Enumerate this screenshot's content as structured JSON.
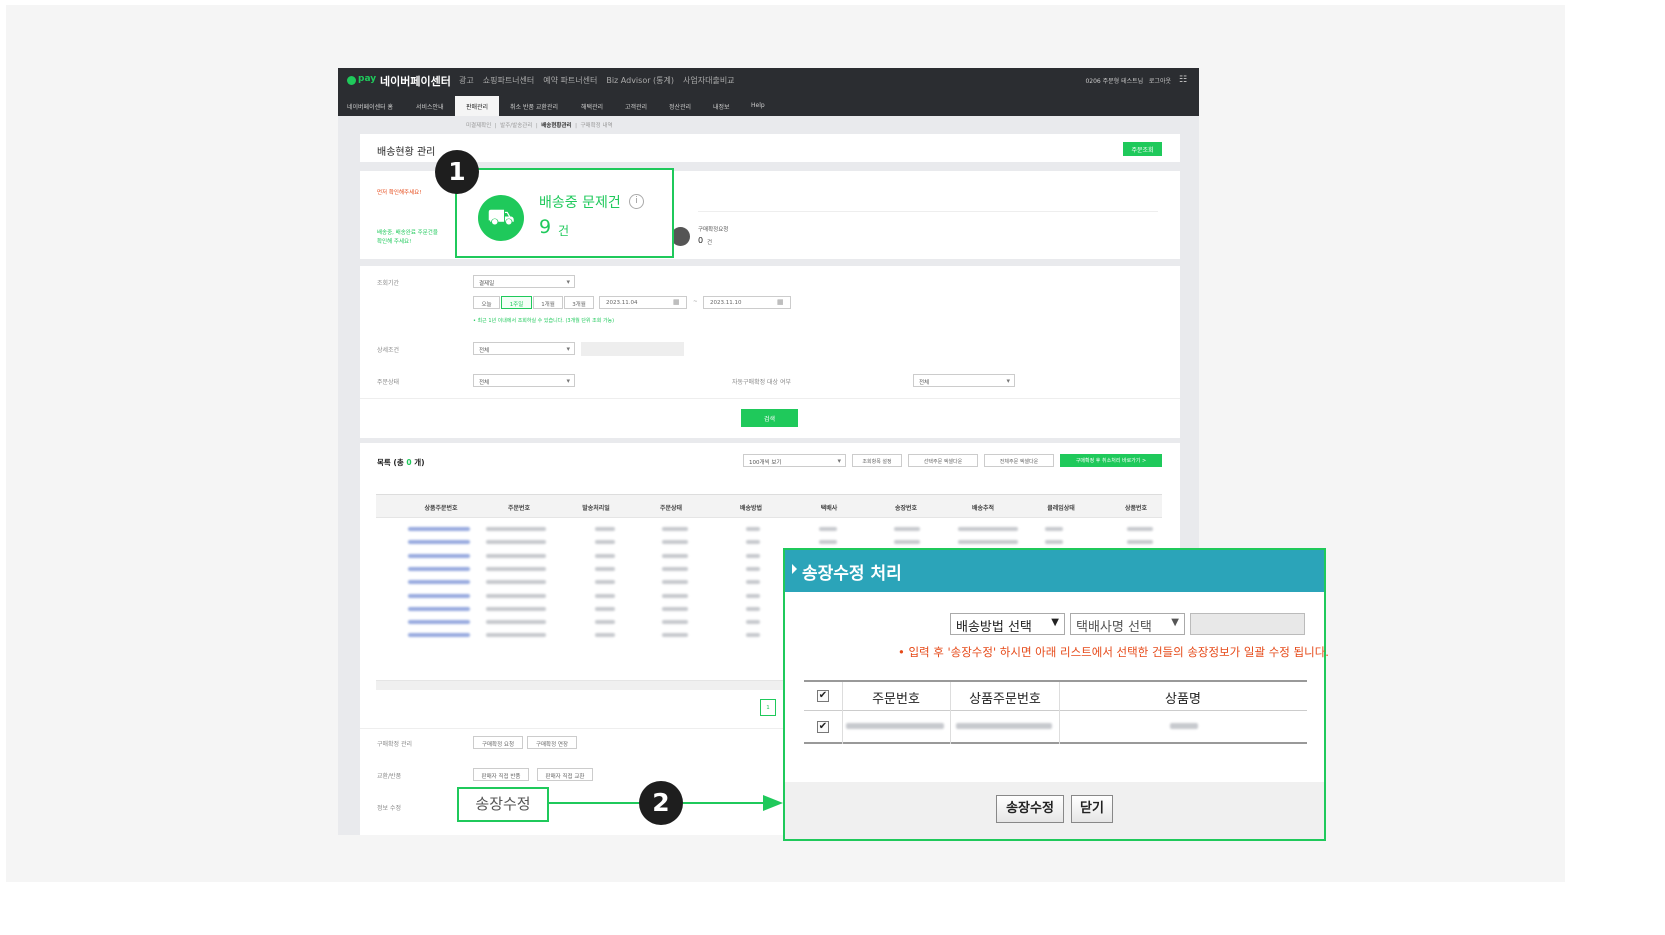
{
  "topbar": {
    "logo": "pay",
    "brand": "네이버페이센터",
    "nav": [
      "광고",
      "쇼핑파트너센터",
      "예약 파트너센터",
      "Biz Advisor (통계)",
      "사업자대출비교"
    ],
    "user": "0206 주문형 테스트님",
    "logout": "로그아웃"
  },
  "subnav": {
    "items": [
      "네이버페이센터 홈",
      "서비스안내",
      "판매관리",
      "취소 반품 교환관리",
      "해택관리",
      "고객관리",
      "정산관리",
      "내정보",
      "Help"
    ],
    "active": "판매관리"
  },
  "breadcrumb": {
    "items": [
      "미결제확인",
      "발주/발송관리",
      "배송현황관리",
      "구매확정 내역"
    ],
    "current": "배송현황관리"
  },
  "page": {
    "title": "배송현황 관리",
    "order_search_button": "주문조회"
  },
  "summary": {
    "notice": "먼저 확인해주세요!",
    "hint_line1": "배송중, 배송완료 주문건을",
    "hint_line2": "확인해 주세요!",
    "purchase_confirm_label": "구매확정요청",
    "purchase_confirm_count": "0",
    "purchase_confirm_unit": "건"
  },
  "filters": {
    "period_label": "조회기간",
    "period_type": "결제일",
    "ranges": [
      "오늘",
      "1주일",
      "1개월",
      "3개월"
    ],
    "active_range": "1주일",
    "date_from": "2023.11.04",
    "date_to": "2023.11.10",
    "date_sep": "~",
    "range_note": "• 최근 1년 이내에서 조회하실 수 있습니다. (3개월 단위 조회 가능)",
    "detail_label": "상세조건",
    "detail_value": "전체",
    "status_label": "주문상태",
    "status_value": "전체",
    "auto_confirm_label": "자동구매확정 대상 여부",
    "auto_confirm_value": "전체",
    "search_button": "검색"
  },
  "list": {
    "title_prefix": "목록 (총 ",
    "count": "0",
    "title_suffix": " 개)",
    "page_size": "100개씩 보기",
    "column_setting": "조회항목 설정",
    "excel_selected": "선택주문 엑셀다운",
    "excel_all": "전체주문 엑셀다운",
    "green_action": "구매확정 후 취소처리 바로가기 >",
    "columns": [
      "상품주문번호",
      "주문번호",
      "발송처리일",
      "주문상태",
      "배송방법",
      "택배사",
      "송장번호",
      "배송추적",
      "클레임상태",
      "상품번호"
    ],
    "page": "1"
  },
  "actions": {
    "purchase_label": "구매확정 관리",
    "purchase_buttons": [
      "구매확정 요청",
      "구매확정 연장"
    ],
    "exchange_label": "교환/반품",
    "exchange_buttons": [
      "판매자 직접 반품",
      "판매자 직접 교환"
    ],
    "info_label": "정보 수정"
  },
  "callout1": {
    "number": "1",
    "title": "배송중 문제건",
    "count": "9",
    "unit": "건",
    "info": "i",
    "icon": "truck-icon"
  },
  "callout2": {
    "number": "2",
    "label": "송장수정"
  },
  "modal": {
    "title": "송장수정 처리",
    "method_select": "배송방법 선택",
    "carrier_select": "택배사명 선택",
    "note": "• 입력 후 '송장수정' 하시면 아래 리스트에서 선택한 건들의 송장정보가 일괄 수정 됩니다.",
    "columns": [
      "주문번호",
      "상품주문번호",
      "상품명"
    ],
    "submit_button": "송장수정",
    "close_button": "닫기"
  },
  "colors": {
    "accent_green": "#1fc95b",
    "modal_header": "#2ba4b9",
    "note_red": "#e64a19",
    "topbar": "#2b2d31"
  }
}
